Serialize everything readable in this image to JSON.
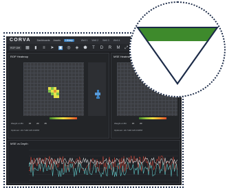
{
  "app": {
    "logo": "CORVA",
    "nav": [
      "Dashboards",
      "Assets",
      "Library"
    ],
    "nav_active": "Library",
    "tabs": [
      "Well 1",
      "Well 2",
      "Well 3",
      "Well 4"
    ]
  },
  "toolbar": {
    "selector_value": "ROP-Diff",
    "icons": [
      "grid-icon",
      "bar-chart-icon",
      "list-icon",
      "pointer-icon",
      "table-icon",
      "circle-icon",
      "palette-icon",
      "shape-icon",
      "text-icon",
      "data-icon",
      "ruler-icon",
      "move-icon",
      "expand-icon"
    ],
    "active_index": 5
  },
  "panels": {
    "left_title": "ROP Heatmap",
    "right_title": "MSE Heatmap",
    "left_sub": "",
    "right_sub": "",
    "left_stats": [
      "Weight on Bit",
      "15",
      "20",
      "25"
    ],
    "right_stats": [
      "Weight on Bit",
      "15",
      "20",
      "25"
    ],
    "left_stats2": [
      "Optimum: 24.7 klbf  125.0 RPM"
    ],
    "right_stats2": [
      "Optimum: 24.7 klbf  125.0 RPM"
    ]
  },
  "chart": {
    "title": "MSE vs Depth",
    "colors": {
      "series_a": "#5fc4c4",
      "series_b": "#c0453a",
      "series_c": "#d7d7d7"
    }
  },
  "callout": {
    "colors": {
      "fill_top": "#3e8a2c",
      "outline": "#1c2b48"
    }
  },
  "colors": {
    "accent": "#3a82c4",
    "heat_yellow": "#e8e24a",
    "heat_green": "#7fc24a",
    "heat_orange": "#e89a3a"
  }
}
